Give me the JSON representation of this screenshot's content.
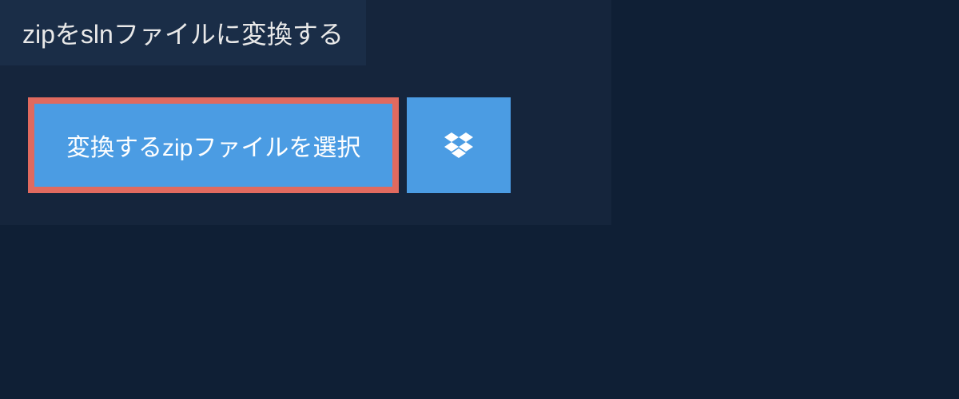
{
  "header": {
    "title": "zipをslnファイルに変換する"
  },
  "actions": {
    "select_file_label": "変換するzipファイルを選択"
  }
}
